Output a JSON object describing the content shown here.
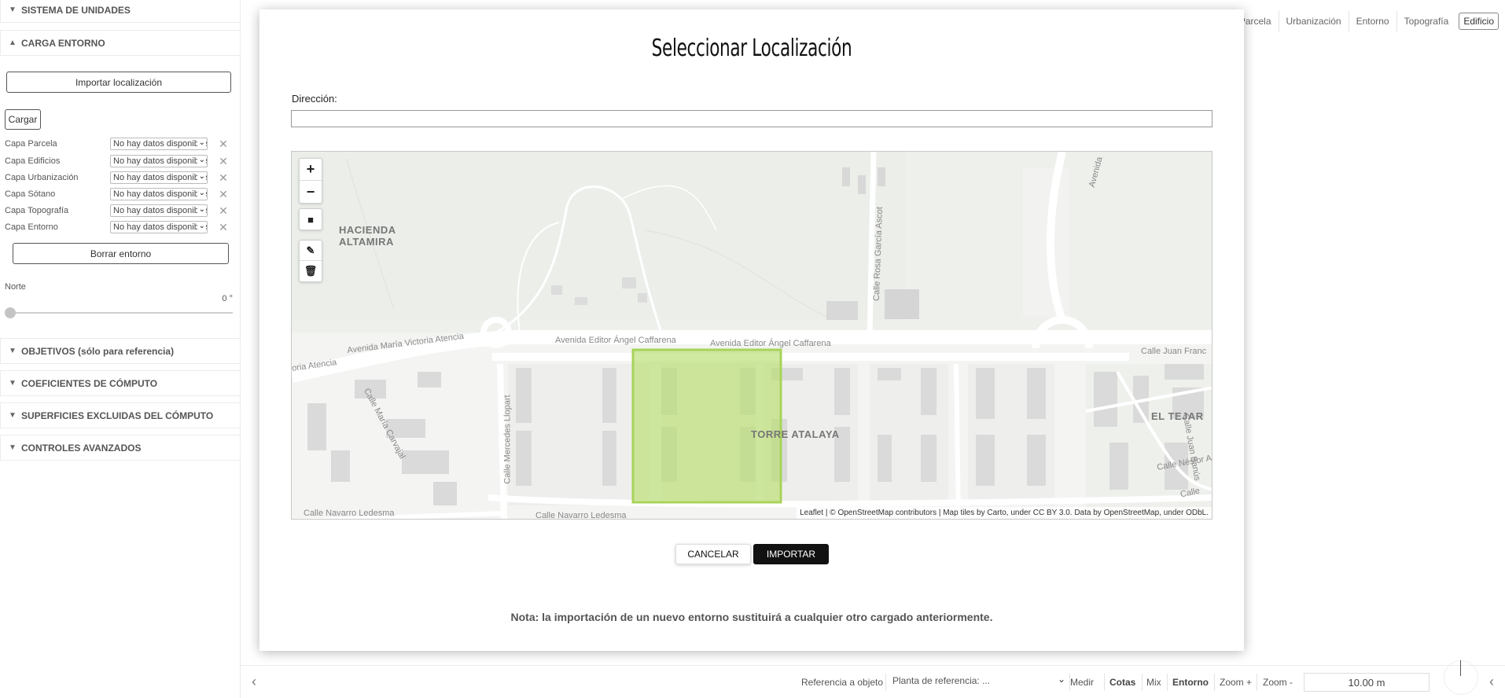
{
  "sidebar": {
    "sections_top": [
      {
        "label": "SISTEMA DE UNIDADES",
        "expanded": false
      },
      {
        "label": "CARGA ENTORNO",
        "expanded": true
      }
    ],
    "import_button": "Importar localización",
    "load_button": "Cargar",
    "layers": [
      {
        "name": "Capa Parcela",
        "value": "No hay datos disponibles"
      },
      {
        "name": "Capa Edificios",
        "value": "No hay datos disponibles"
      },
      {
        "name": "Capa Urbanización",
        "value": "No hay datos disponibles"
      },
      {
        "name": "Capa Sótano",
        "value": "No hay datos disponibles"
      },
      {
        "name": "Capa Topografía",
        "value": "No hay datos disponibles"
      },
      {
        "name": "Capa Entorno",
        "value": "No hay datos disponibles"
      }
    ],
    "clear_button": "Borrar entorno",
    "north_label": "Norte",
    "north_value": "0 °",
    "sections_bottom": [
      {
        "label": "OBJETIVOS (sólo para referencia)"
      },
      {
        "label": "COEFICIENTES DE CÓMPUTO"
      },
      {
        "label": "SUPERFICIES EXCLUIDAS DEL CÓMPUTO"
      },
      {
        "label": "CONTROLES AVANZADOS"
      }
    ]
  },
  "top_tabs": [
    {
      "label": "Parcela",
      "active": false
    },
    {
      "label": "Urbanización",
      "active": false
    },
    {
      "label": "Entorno",
      "active": false
    },
    {
      "label": "Topografía",
      "active": false
    },
    {
      "label": "Edificio",
      "active": true
    }
  ],
  "modal": {
    "title": "Seleccionar Localización",
    "address_label": "Dirección:",
    "address_value": "",
    "map": {
      "zoom_in": "+",
      "zoom_out": "−",
      "area_labels": {
        "hacienda_1": "HACIENDA",
        "hacienda_2": "ALTAMIRA",
        "torre": "TORRE ATALAYA",
        "tejar": "EL TEJAR"
      },
      "streets": {
        "victoria_1": "Avenida María Victoria Atencia",
        "victoria_2": "oria Atencia",
        "caffarena_1": "Avenida Editor Ángel Caffarena",
        "caffarena_2": "Avenida Editor Ángel Caffarena",
        "juan_franc": "Calle Juan Franc",
        "navarro_1": "Calle Navarro Ledesma",
        "navarro_2": "Calle Navarro Ledesma",
        "mercedes": "Calle Mercedes Llopart",
        "maria_carvajal": "Calle María Carvajal",
        "rosa_garcia": "Calle Rosa García Ascot",
        "avenida_top": "Avenida",
        "juan_banus": "Calle Juan Banús",
        "nestor": "Calle Néstor A",
        "calle_bottom_right": "Calle"
      },
      "attribution": "Leaflet | © OpenStreetMap contributors | Map tiles by Carto, under CC BY 3.0. Data by OpenStreetMap, under ODbL.",
      "selection_color": "#a8d35a"
    },
    "cancel_button": "CANCELAR",
    "import_button": "IMPORTAR",
    "note": "Nota: la importación de un nuevo entorno sustituirá a cualquier otro cargado anteriormente."
  },
  "bottom_bar": {
    "ref_object": "Referencia a objeto",
    "ref_plant": "Planta de referencia:  ...",
    "measure": "Medir",
    "dims": "Cotas",
    "mix": "Mix",
    "environment": "Entorno",
    "zoom_in": "Zoom +",
    "zoom_out": "Zoom -",
    "zoom_value": "10.00 m"
  }
}
